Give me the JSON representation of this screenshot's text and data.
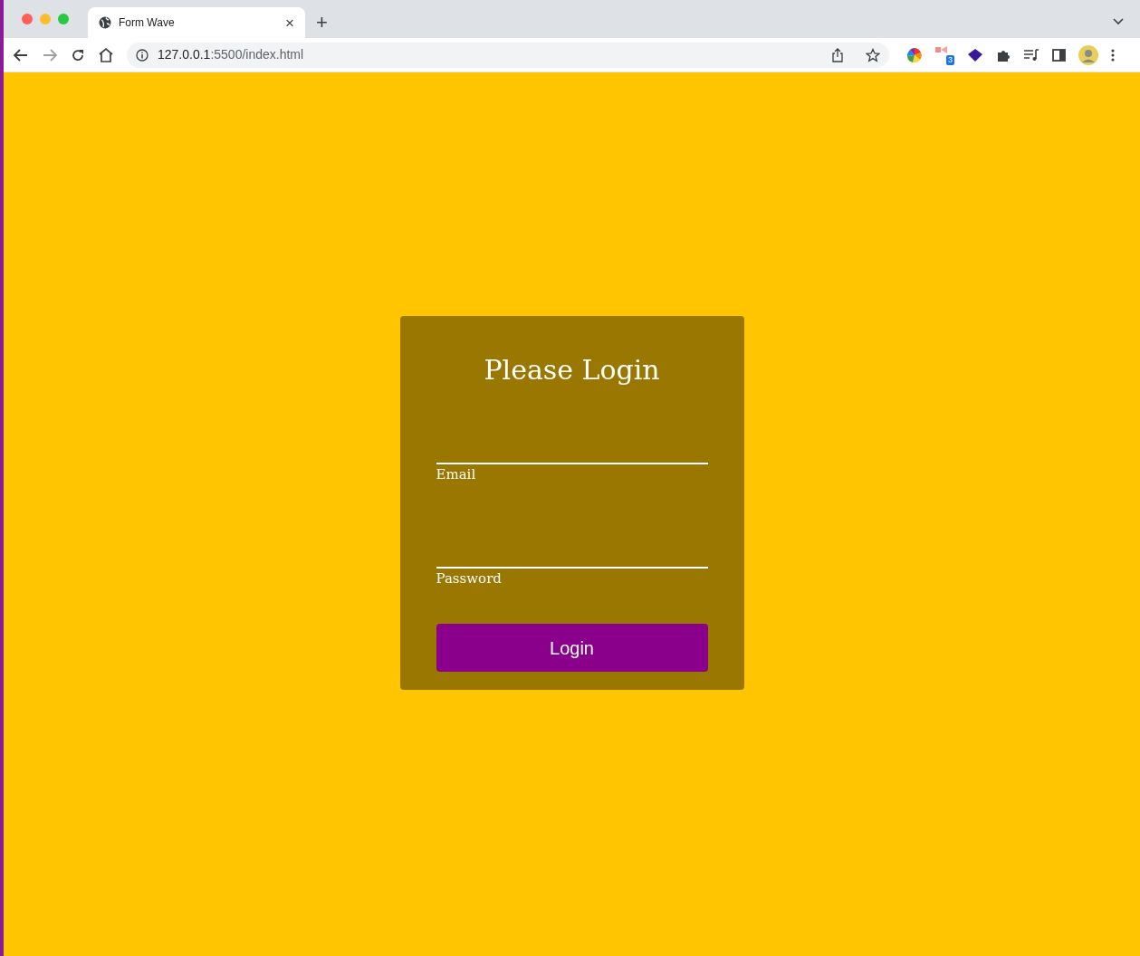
{
  "browser": {
    "tab": {
      "title": "Form Wave",
      "close": "×"
    },
    "new_tab": "+",
    "address": {
      "host": "127.0.0.1",
      "rest": ":5500/index.html"
    },
    "extension_badge": "3"
  },
  "form": {
    "title": "Please Login",
    "fields": [
      {
        "label": "Email"
      },
      {
        "label": "Password"
      }
    ],
    "submit": "Login"
  }
}
